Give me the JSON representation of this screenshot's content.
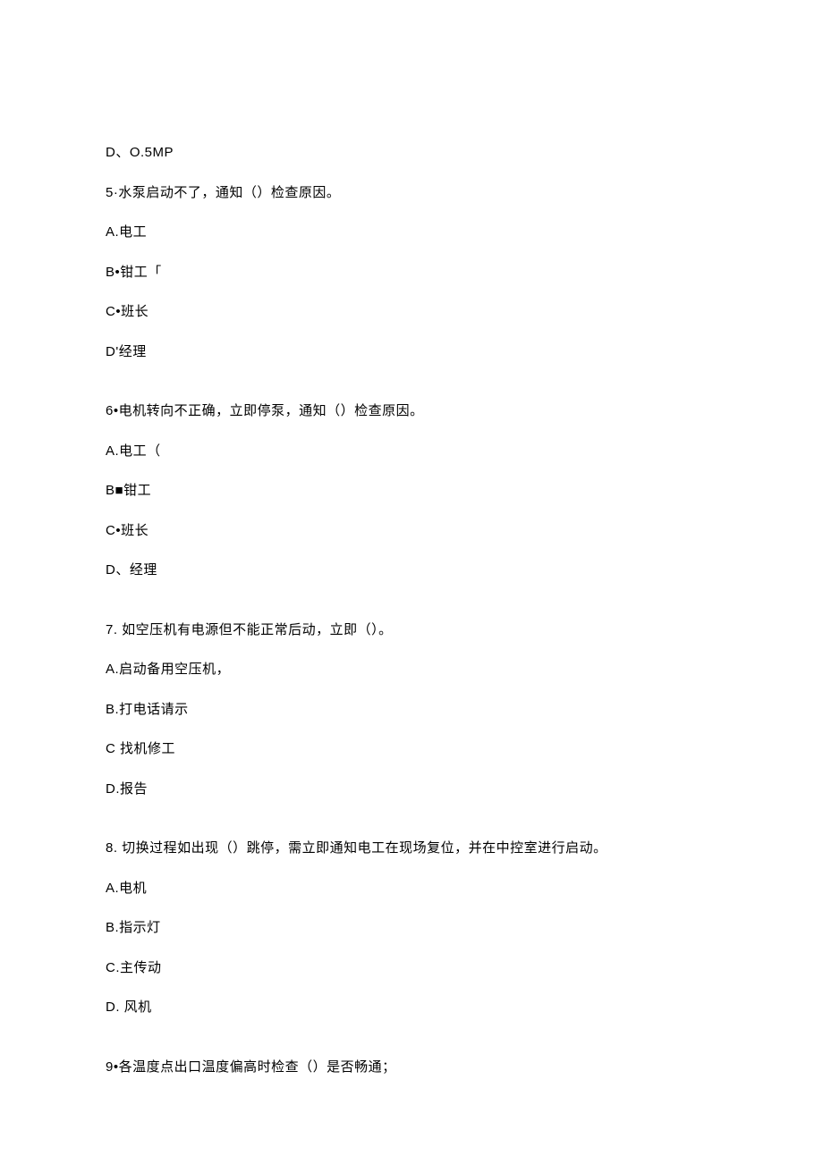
{
  "lines": [
    {
      "text": "D、O.5MP",
      "gap": false
    },
    {
      "text": "5·水泵启动不了，通知（）检查原因。",
      "gap": false
    },
    {
      "text": "A.电工",
      "gap": false
    },
    {
      "text": "B•钳工「",
      "gap": false
    },
    {
      "text": "C•班长",
      "gap": false
    },
    {
      "text": "D'经理",
      "gap": false
    },
    {
      "text": "6•电机转向不正确，立即停泵，通知（）检查原因。",
      "gap": true
    },
    {
      "text": "A.电工（",
      "gap": false
    },
    {
      "text": "B■钳工",
      "gap": false
    },
    {
      "text": "C•班长",
      "gap": false
    },
    {
      "text": "D、经理",
      "gap": false
    },
    {
      "text": "7. 如空压机有电源但不能正常后动，立即（）。",
      "gap": true
    },
    {
      "text": "A.启动备用空压机，",
      "gap": false
    },
    {
      "text": "B.打电话请示",
      "gap": false
    },
    {
      "text": "C 找机修工",
      "gap": false
    },
    {
      "text": "D.报告",
      "gap": false
    },
    {
      "text": "8. 切换过程如出现（）跳停，需立即通知电工在现场复位，并在中控室进行启动。",
      "gap": true
    },
    {
      "text": "A.电机",
      "gap": false
    },
    {
      "text": "B.指示灯",
      "gap": false
    },
    {
      "text": "C.主传动",
      "gap": false
    },
    {
      "text": "D. 风机",
      "gap": false
    },
    {
      "text": "9•各温度点出口温度偏高时检查（）是否畅通；",
      "gap": true
    }
  ]
}
